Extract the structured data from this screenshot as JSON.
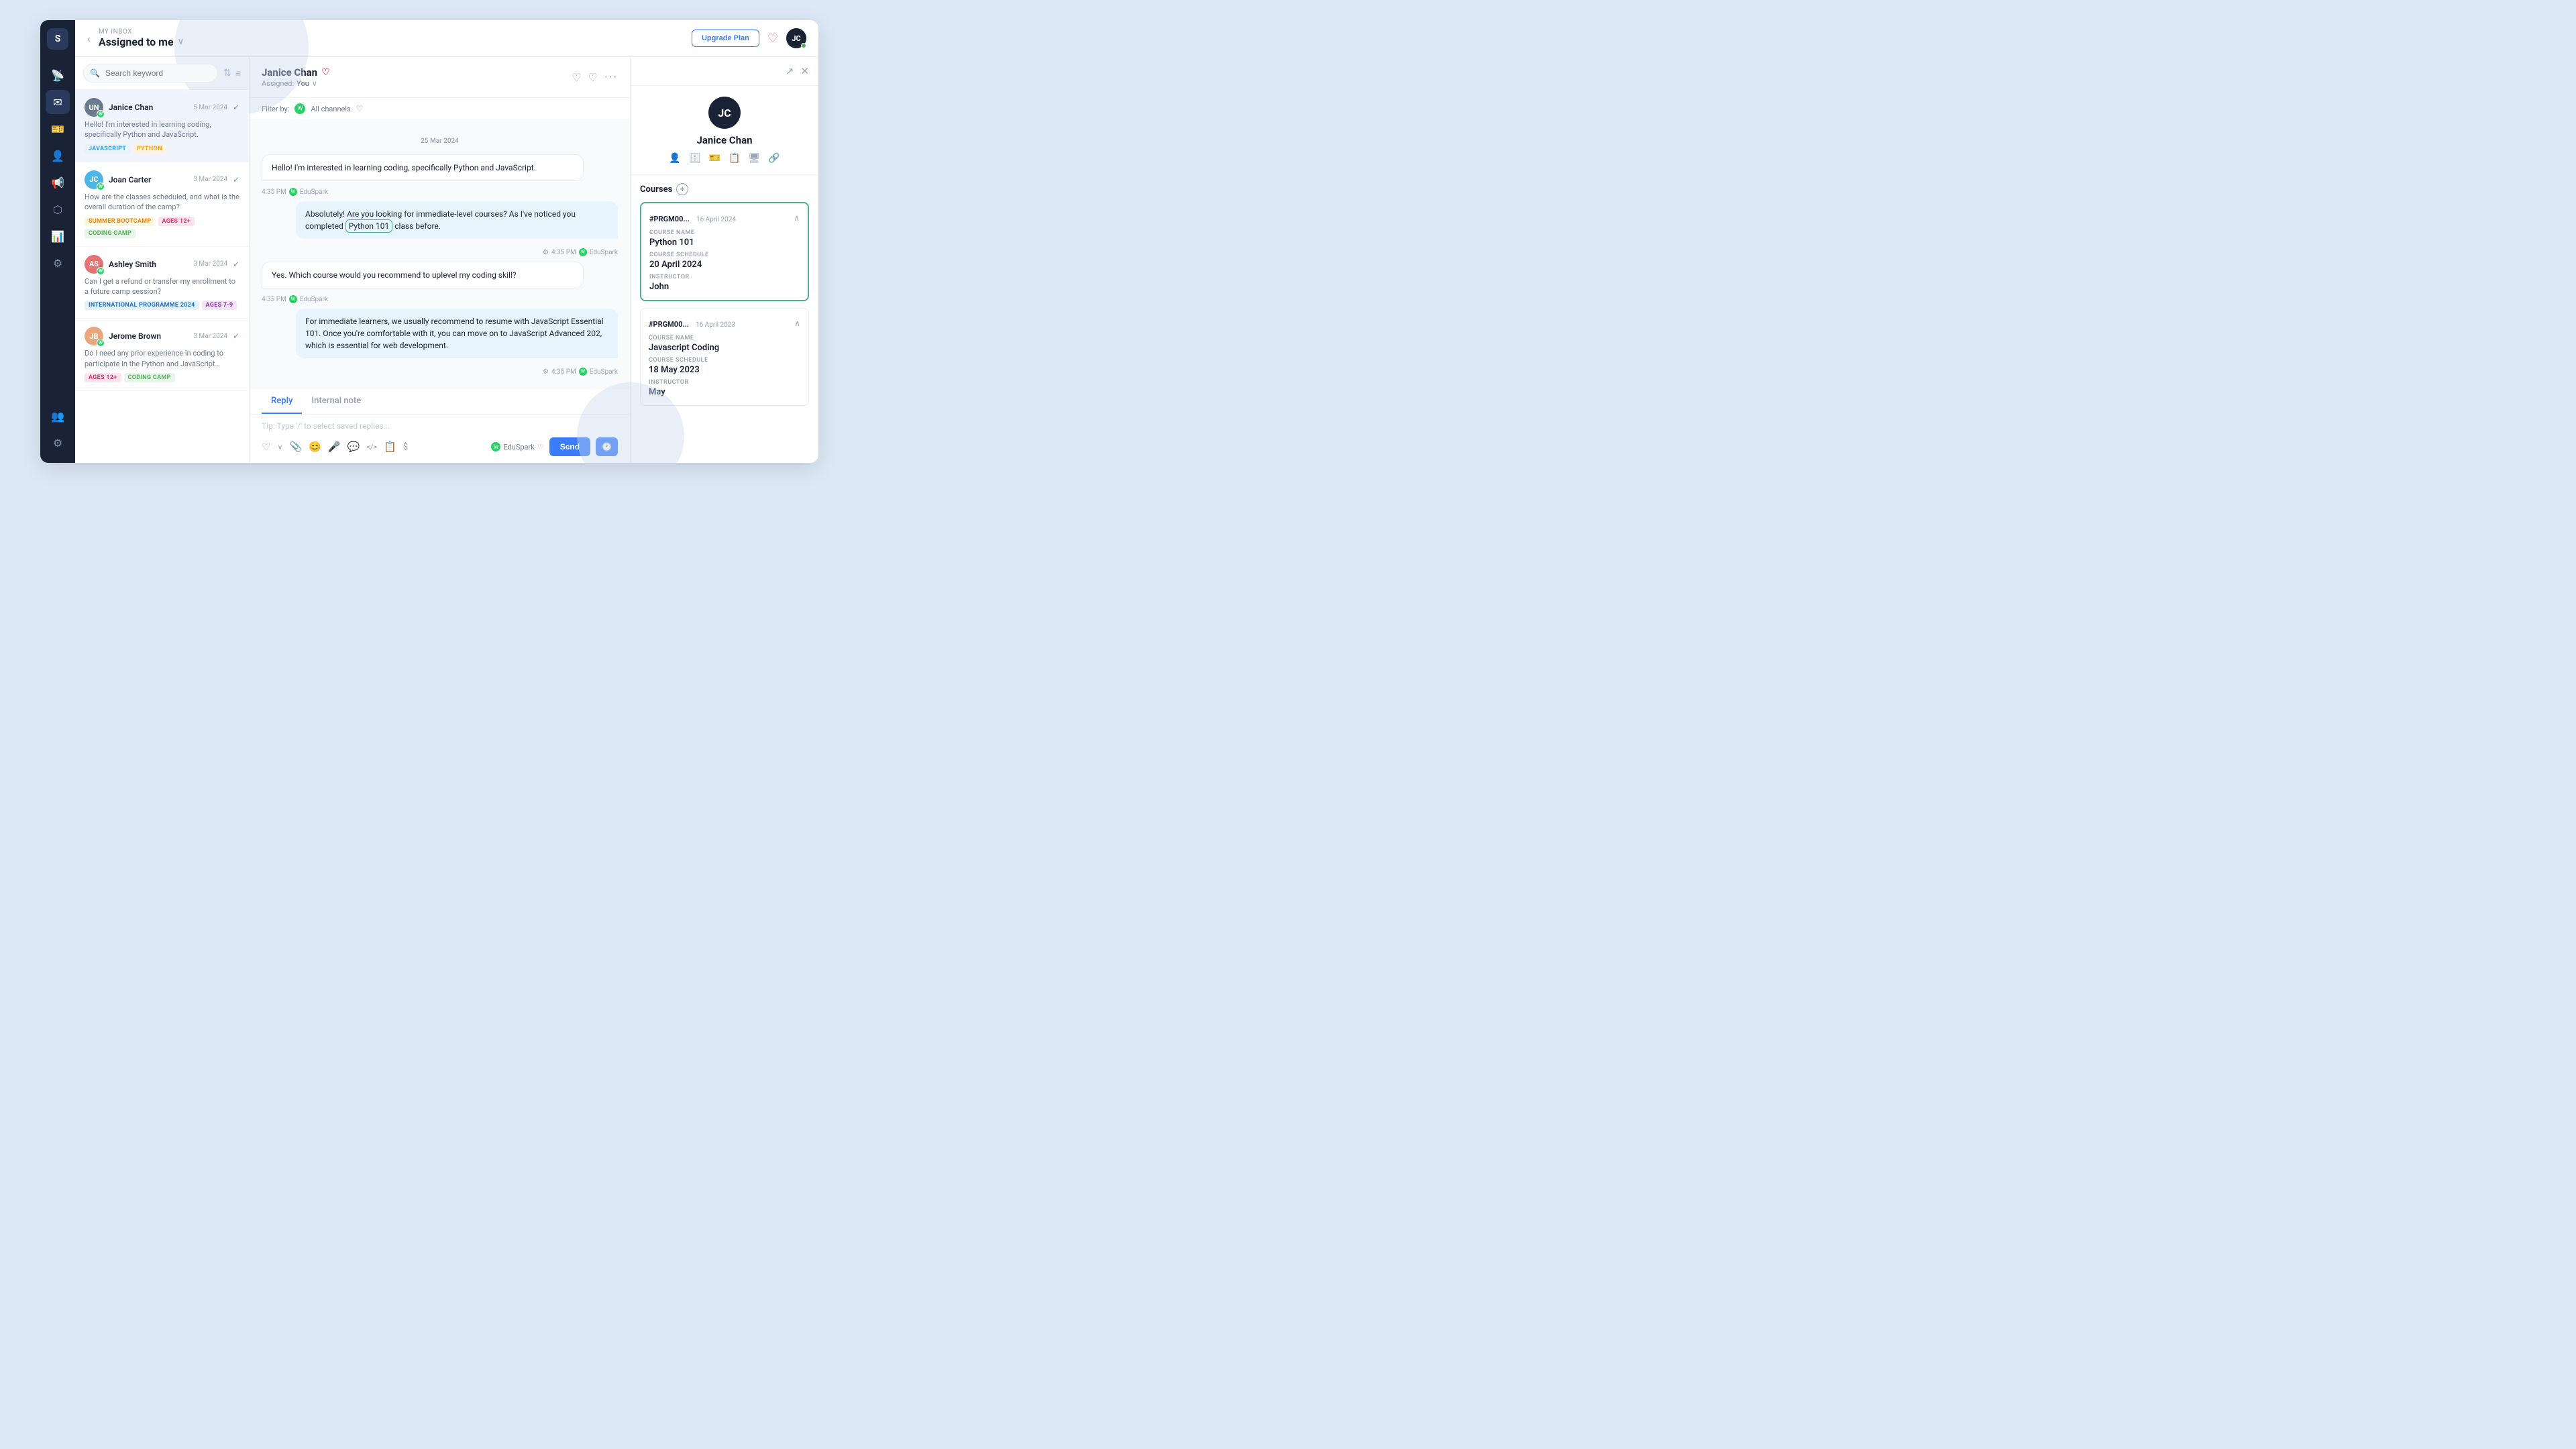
{
  "app": {
    "logo": "S",
    "upgrade_label": "Upgrade Plan",
    "user_initials": "JC"
  },
  "header": {
    "my_inbox": "MY INBOX",
    "assigned_to_me": "Assigned to me",
    "back_icon": "chevron-left",
    "dropdown_icon": "chevron-down"
  },
  "search": {
    "placeholder": "Search keyword",
    "sort_icon": "sort-icon",
    "filter_icon": "filter-icon"
  },
  "conversations": [
    {
      "id": "conv-1",
      "avatar_initials": "UN",
      "avatar_color": "#6b7a8d",
      "name": "Janice Chan",
      "date": "5 Mar 2024",
      "preview": "Hello! I'm interested in learning coding, specifically Python and JavaScript.",
      "tags": [
        {
          "label": "JAVASCRIPT",
          "type": "js"
        },
        {
          "label": "PYTHON",
          "type": "python"
        }
      ],
      "active": true
    },
    {
      "id": "conv-2",
      "avatar_initials": "JC",
      "avatar_color": "#4db6e8",
      "name": "Joan Carter",
      "date": "3 Mar 2024",
      "preview": "How are the classes scheduled, and what is the overall duration of the camp?",
      "tags": [
        {
          "label": "SUMMER BOOTCAMP",
          "type": "summer"
        },
        {
          "label": "AGES 12+",
          "type": "ages12"
        },
        {
          "label": "CODING CAMP",
          "type": "coding"
        }
      ],
      "active": false
    },
    {
      "id": "conv-3",
      "avatar_initials": "AS",
      "avatar_color": "#e57373",
      "name": "Ashley Smith",
      "date": "3 Mar 2024",
      "preview": "Can I get a refund or transfer my enrollment to a future camp session?",
      "tags": [
        {
          "label": "INTERNATIONAL PROGRAMME 2024",
          "type": "intl"
        },
        {
          "label": "AGES 7-9",
          "type": "ages79"
        }
      ],
      "active": false
    },
    {
      "id": "conv-4",
      "avatar_initials": "JB",
      "avatar_color": "#e8a87c",
      "name": "Jerome Brown",
      "date": "3 Mar 2024",
      "preview": "Do I need any prior experience in coding to participate in the Python and JavaScript courses?",
      "tags": [
        {
          "label": "AGES 12+",
          "type": "ages12"
        },
        {
          "label": "CODING CAMP",
          "type": "coding"
        }
      ],
      "active": false
    }
  ],
  "chat": {
    "contact_name": "Janice Chan",
    "assigned_label": "Assigned:",
    "assigned_to": "You",
    "filter_label": "Filter by:",
    "channel_label": "All channels",
    "date_divider": "25 Mar 2024",
    "messages": [
      {
        "id": "msg-1",
        "type": "incoming",
        "text": "Hello! I'm interested in learning coding, specifically Python and JavaScript.",
        "time": "4:35 PM",
        "channel": "EduSpark"
      },
      {
        "id": "msg-2",
        "type": "outgoing",
        "text_pre": "Absolutely! Are you looking for immediate-level courses? As I've noticed you completed ",
        "highlight": "Python 101",
        "text_post": " class before.",
        "time": "4:35 PM",
        "channel": "EduSpark"
      },
      {
        "id": "msg-3",
        "type": "incoming",
        "text": "Yes. Which course would you recommend to uplevel my coding skill?",
        "time": "4:35 PM",
        "channel": "EduSpark"
      },
      {
        "id": "msg-4",
        "type": "outgoing",
        "text": "For immediate learners, we usually recommend to resume with JavaScript Essential 101. Once you're comfortable with it, you can move on to JavaScript Advanced 202, which is essential for web development.",
        "time": "4:35 PM",
        "channel": "EduSpark"
      }
    ],
    "reply_tab": "Reply",
    "internal_note_tab": "Internal note",
    "reply_placeholder": "Tip: Type '/' to select saved replies...",
    "eduspark_label": "EduSpark",
    "send_label": "Send"
  },
  "right_panel": {
    "contact_initials": "JC",
    "contact_name": "Janice Chan",
    "courses_title": "Courses",
    "courses": [
      {
        "id": "#PRGM00...",
        "date": "16 April 2024",
        "active": true,
        "course_name_label": "COURSE NAME",
        "course_name": "Python 101",
        "schedule_label": "COURSE SCHEDULE",
        "schedule": "20 April 2024",
        "instructor_label": "INSTRUCTOR",
        "instructor": "John"
      },
      {
        "id": "#PRGM00...",
        "date": "16 April 2023",
        "active": false,
        "course_name_label": "COURSE NAME",
        "course_name": "Javascript Coding",
        "schedule_label": "COURSE SCHEDULE",
        "schedule": "18 May 2023",
        "instructor_label": "INSTRUCTOR",
        "instructor": "May"
      }
    ]
  },
  "icons": {
    "inbox": "✉",
    "broadcast": "📡",
    "contacts": "👤",
    "campaigns": "📢",
    "workflows": "⚙",
    "reports": "📊",
    "integrations": "🔌",
    "settings": "⚙",
    "add_user": "👥",
    "whatsapp": "W",
    "sort": "⇅",
    "filter": "≡",
    "heart": "♡",
    "heart_filled": "♥",
    "more": "···",
    "external": "↗",
    "close": "✕",
    "chevron_down": "∨",
    "chevron_up": "∧",
    "back": "‹",
    "search": "🔍",
    "attach": "📎",
    "emoji": "😊",
    "mic": "🎤",
    "chat": "💬",
    "code": "</>",
    "copy": "📋",
    "dollar": "$",
    "gear": "⚙",
    "clock": "🕐",
    "person": "👤",
    "database": "🗄",
    "ticket": "🎫",
    "clipboard": "📋",
    "monitor": "🖥",
    "link": "🔗"
  }
}
